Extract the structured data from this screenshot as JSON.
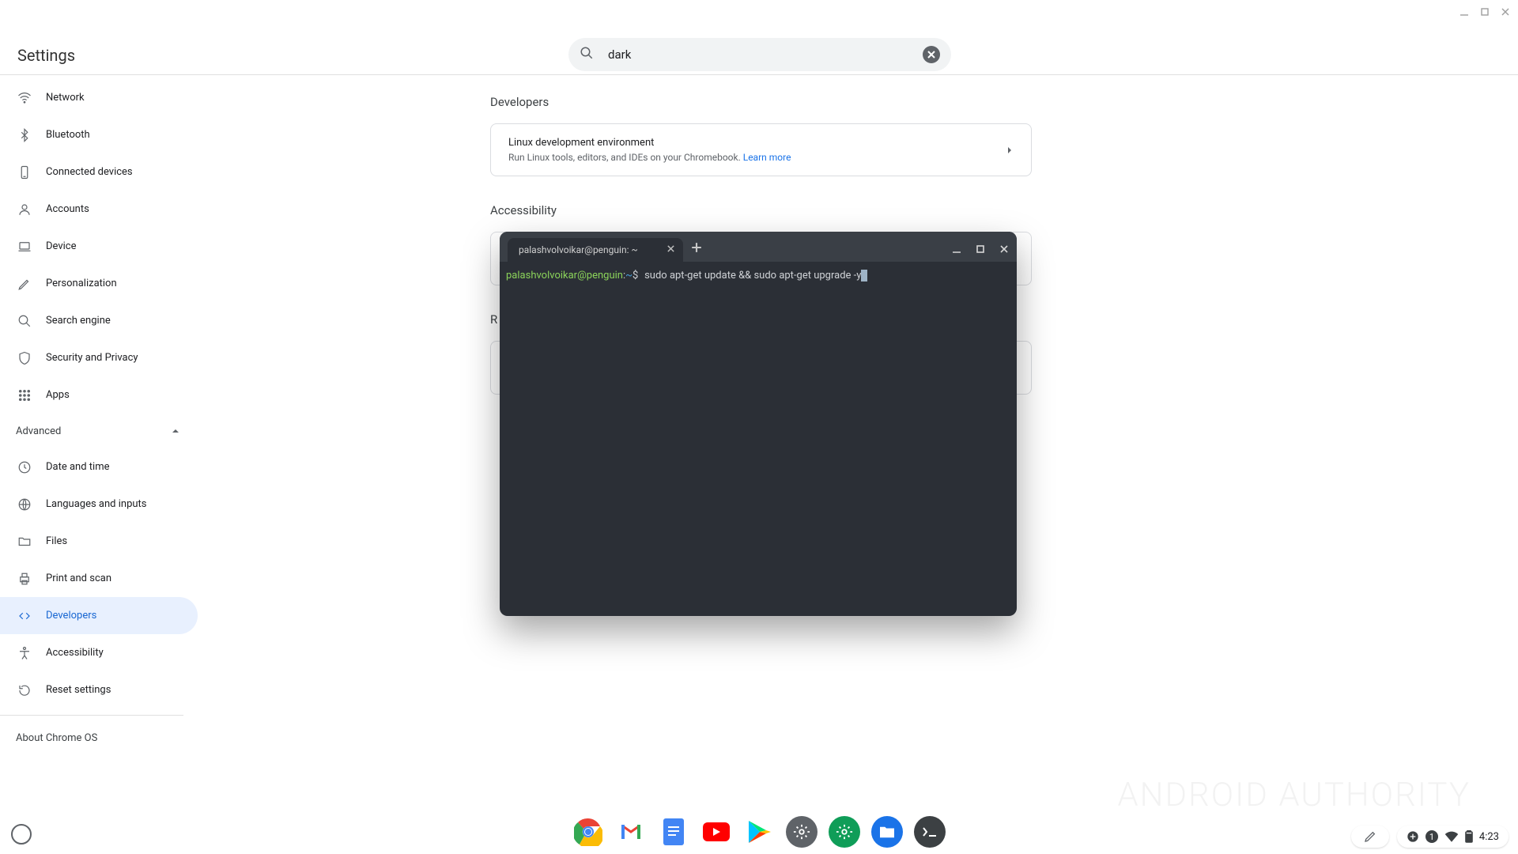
{
  "window": {
    "title": "Settings"
  },
  "search": {
    "value": "dark"
  },
  "sidebar": {
    "items": [
      {
        "label": "Network"
      },
      {
        "label": "Bluetooth"
      },
      {
        "label": "Connected devices"
      },
      {
        "label": "Accounts"
      },
      {
        "label": "Device"
      },
      {
        "label": "Personalization"
      },
      {
        "label": "Search engine"
      },
      {
        "label": "Security and Privacy"
      },
      {
        "label": "Apps"
      }
    ],
    "advanced_label": "Advanced",
    "advanced_items": [
      {
        "label": "Date and time"
      },
      {
        "label": "Languages and inputs"
      },
      {
        "label": "Files"
      },
      {
        "label": "Print and scan"
      },
      {
        "label": "Developers"
      },
      {
        "label": "Accessibility"
      },
      {
        "label": "Reset settings"
      }
    ],
    "about_label": "About Chrome OS"
  },
  "main": {
    "sections": {
      "developers": {
        "title": "Developers",
        "card_title": "Linux development environment",
        "card_sub": "Run Linux tools, editors, and IDEs on your Chromebook. ",
        "learn_more": "Learn more"
      },
      "accessibility": {
        "title": "Accessibility"
      },
      "reset_prefix": "R"
    }
  },
  "terminal": {
    "tab_title": "palashvolvoikar@penguin: ~",
    "prompt_user": "palashvolvoikar@penguin",
    "prompt_path": "~",
    "prompt_sep": ":",
    "prompt_char": "$",
    "command": "sudo apt-get update && sudo apt-get upgrade -y"
  },
  "tray": {
    "notification_count": "1",
    "time": "4:23"
  },
  "watermark": {
    "a": "ANDROID",
    "b": "AUTHORITY"
  }
}
